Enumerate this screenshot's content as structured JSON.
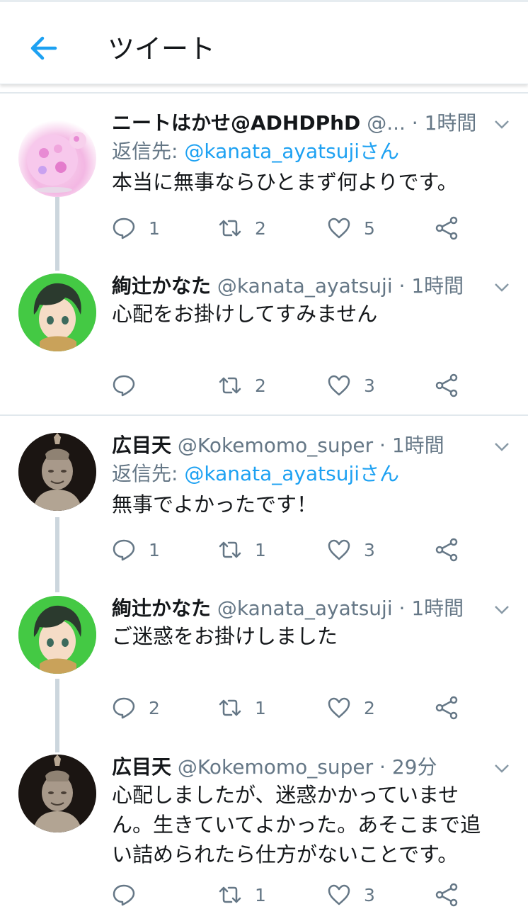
{
  "header": {
    "title": "ツイート"
  },
  "tweets": [
    {
      "name": "ニートはかせ@ADHDPhD",
      "handle": "@...",
      "dot": " · ",
      "time": "1時間",
      "reply_prefix": "返信先: ",
      "reply_to": "@kanata_ayatsujiさん",
      "text": "本当に無事ならひとまず何よりです。",
      "replies": "1",
      "retweets": "2",
      "likes": "5"
    },
    {
      "name": "絢辻かなた",
      "handle": "@kanata_ayatsuji",
      "dot": " · ",
      "time": "1時間",
      "text": "心配をお掛けしてすみません",
      "replies": "",
      "retweets": "2",
      "likes": "3"
    },
    {
      "name": "広目天",
      "handle": "@Kokemomo_super",
      "dot": " · ",
      "time": "1時間",
      "reply_prefix": "返信先: ",
      "reply_to": "@kanata_ayatsujiさん",
      "text": "無事でよかったです！",
      "replies": "1",
      "retweets": "1",
      "likes": "3"
    },
    {
      "name": "絢辻かなた",
      "handle": "@kanata_ayatsuji",
      "dot": " · ",
      "time": "1時間",
      "text": "ご迷惑をお掛けしました",
      "replies": "2",
      "retweets": "1",
      "likes": "2"
    },
    {
      "name": "広目天",
      "handle": "@Kokemomo_super",
      "dot": " · ",
      "time": "29分",
      "text": "心配しましたが、迷惑かかっていません。生きていてよかった。あそこまで追い詰められたら仕方がないことです。",
      "replies": "",
      "retweets": "1",
      "likes": "3"
    }
  ],
  "icons": {
    "back": "arrow-left-icon",
    "reply": "reply-icon",
    "retweet": "retweet-icon",
    "like": "heart-icon",
    "share": "share-icon",
    "more": "chevron-down-icon"
  },
  "colors": {
    "accent": "#1da1f2",
    "muted": "#657786",
    "text": "#14171a",
    "line": "#ccd6dd"
  }
}
